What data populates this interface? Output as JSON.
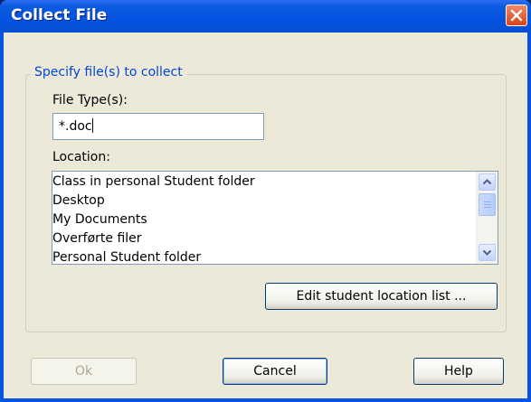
{
  "window": {
    "title": "Collect File"
  },
  "group": {
    "legend": "Specify file(s) to collect"
  },
  "file_type": {
    "label": "File Type(s):",
    "value": "*.doc"
  },
  "location": {
    "label": "Location:",
    "items": [
      "Class in personal Student folder",
      "Desktop",
      "My Documents",
      "Overførte filer",
      "Personal Student folder"
    ]
  },
  "buttons": {
    "edit_list": "Edit student location list ...",
    "ok": "Ok",
    "cancel": "Cancel",
    "help": "Help"
  },
  "colors": {
    "title_bar": "#0553e2",
    "group_legend": "#0046d5",
    "dialog_face": "#ece9d8",
    "close_button": "#d94318"
  }
}
